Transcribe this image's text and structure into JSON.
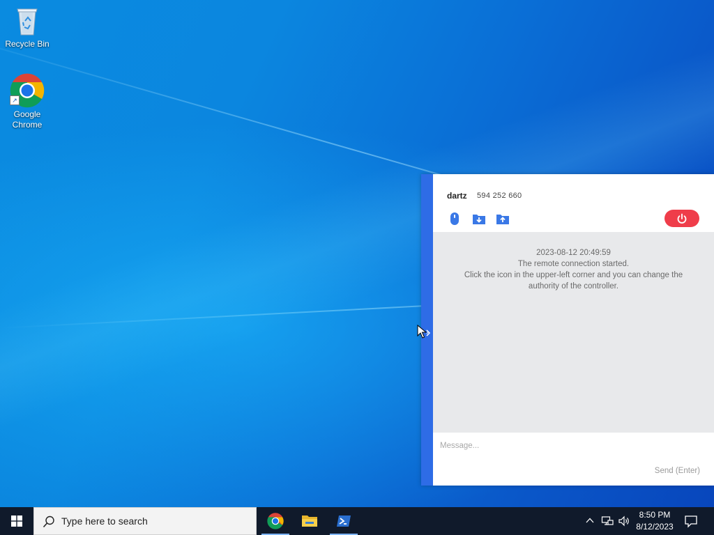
{
  "desktop": {
    "icons": [
      {
        "label": "Recycle Bin",
        "icon": "recycle-bin-icon"
      },
      {
        "label": "Google\nChrome",
        "icon": "chrome-icon"
      }
    ]
  },
  "remote_panel": {
    "user_name": "dartz",
    "user_id": "594 252 660",
    "tools": [
      "mouse-icon",
      "download-folder-icon",
      "upload-folder-icon"
    ],
    "power_icon": "power-icon",
    "accent_color": "#2e6ce6",
    "power_color": "#ef3d4a",
    "chat": {
      "timestamp": "2023-08-12 20:49:59",
      "line1": "The remote connection started.",
      "line2": "Click the icon in the upper-left corner and you can change the\nauthority of the controller."
    },
    "input": {
      "placeholder": "Message...",
      "value": ""
    },
    "send_label": "Send (Enter)"
  },
  "taskbar": {
    "search_placeholder": "Type here to search",
    "apps": [
      "chrome-icon",
      "file-explorer-icon",
      "powershell-icon"
    ],
    "tray": [
      "chevron-up-icon",
      "network-icon",
      "volume-icon"
    ],
    "time": "8:50 PM",
    "date": "8/12/2023"
  }
}
